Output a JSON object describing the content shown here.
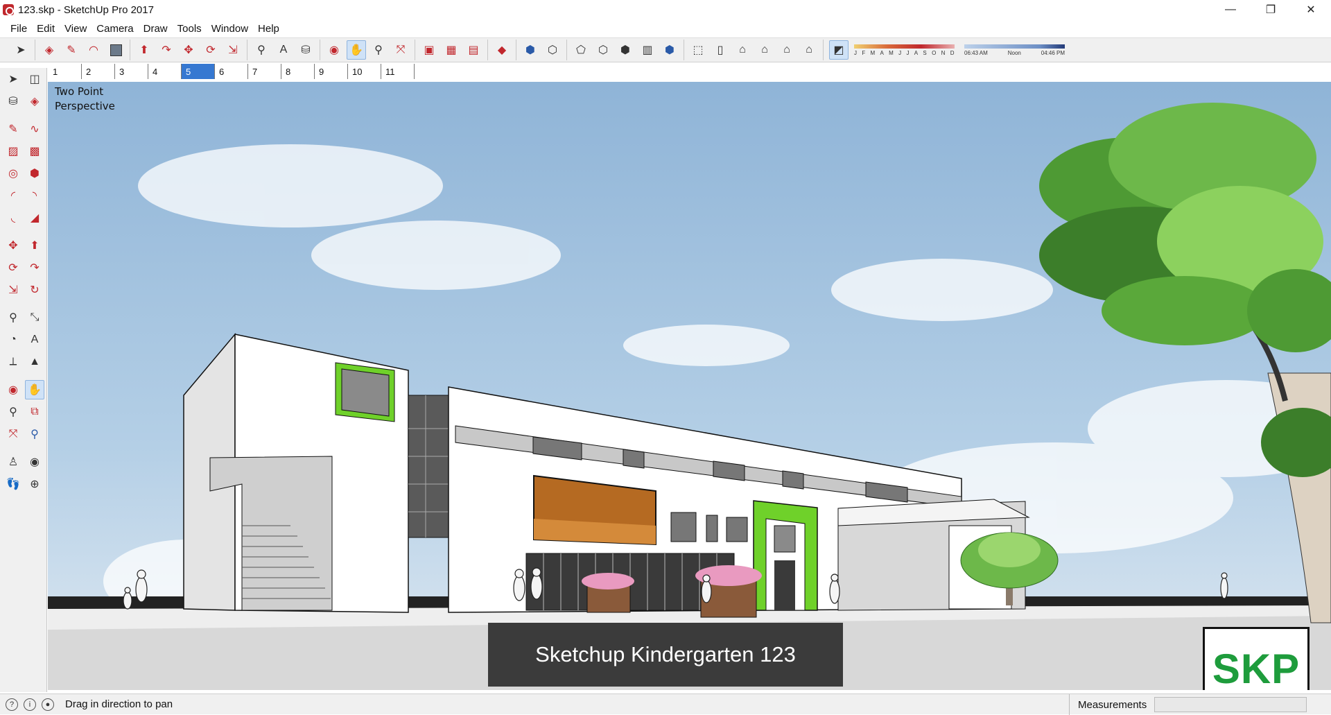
{
  "window": {
    "title": "123.skp - SketchUp Pro 2017",
    "minimize": "—",
    "maximize": "❐",
    "close": "✕"
  },
  "menu": [
    "File",
    "Edit",
    "View",
    "Camera",
    "Draw",
    "Tools",
    "Window",
    "Help"
  ],
  "scene_tabs": [
    "1",
    "2",
    "3",
    "4",
    "5",
    "6",
    "7",
    "8",
    "9",
    "10",
    "11"
  ],
  "active_scene": "5",
  "shadow_panel": {
    "months": [
      "J",
      "F",
      "M",
      "A",
      "M",
      "J",
      "J",
      "A",
      "S",
      "O",
      "N",
      "D"
    ],
    "time_start": "06:43 AM",
    "time_mid": "Noon",
    "time_end": "04:46 PM"
  },
  "viewport": {
    "camera_mode_line1": "Two Point",
    "camera_mode_line2": "Perspective",
    "caption": "Sketchup Kindergarten 123",
    "logo": "SKP"
  },
  "status": {
    "hint": "Drag in direction to pan",
    "measurements_label": "Measurements",
    "measurements_value": ""
  },
  "colors": {
    "accent_green": "#6fd12a",
    "sky": "#9fc1df",
    "active_tab": "#3678d1",
    "logo_green": "#1e9c3c"
  }
}
